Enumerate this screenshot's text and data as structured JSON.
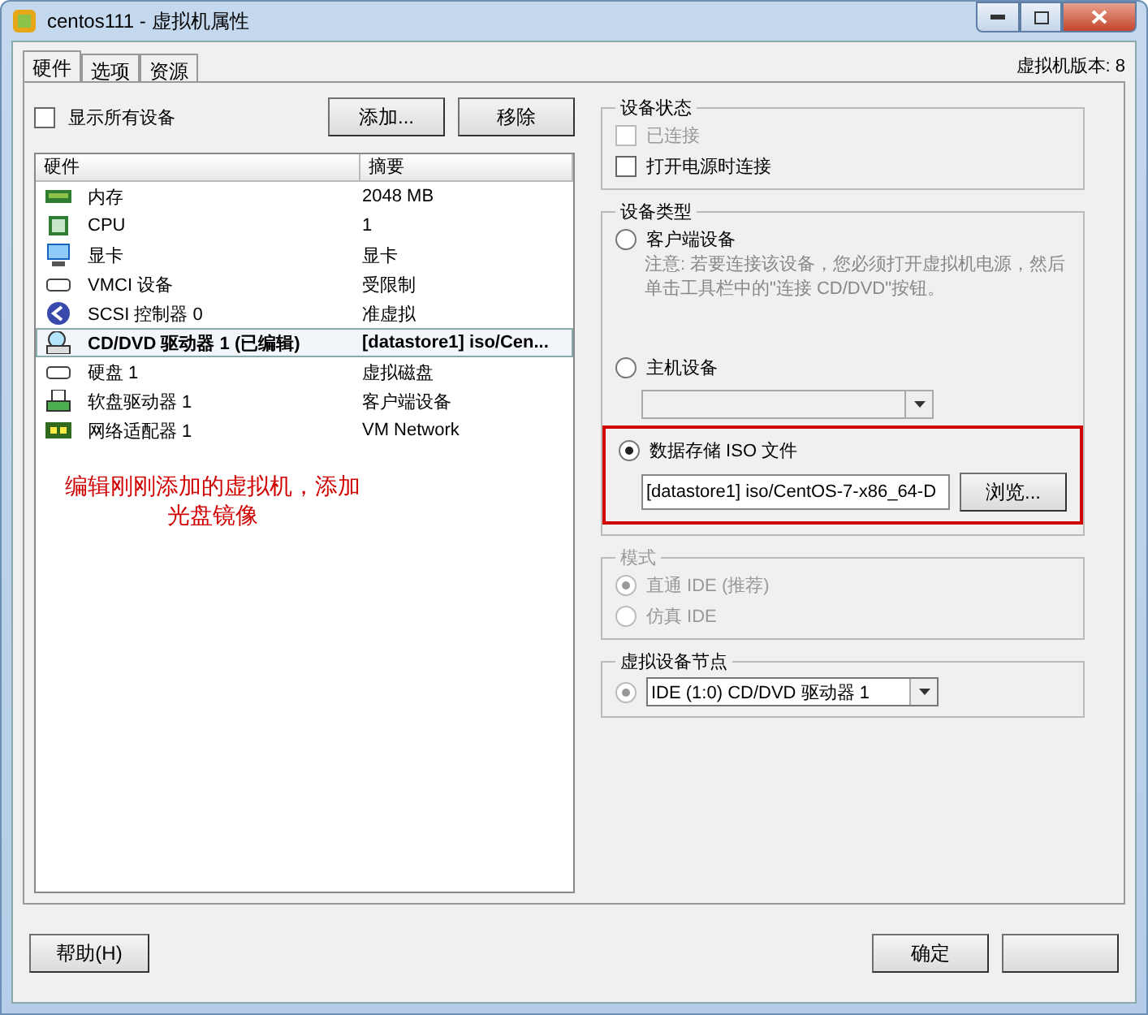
{
  "window": {
    "title": "centos111 - 虚拟机属性"
  },
  "tabs": [
    {
      "label": "硬件",
      "selected": true
    },
    {
      "label": "选项",
      "selected": false
    },
    {
      "label": "资源",
      "selected": false
    }
  ],
  "version_label": "虚拟机版本: 8",
  "show_all_devices": {
    "label": "显示所有设备",
    "checked": false
  },
  "list_buttons": [
    "添加...",
    "移除"
  ],
  "hardware_table": {
    "columns": [
      "硬件",
      "摘要"
    ],
    "rows": [
      {
        "kind": "memory",
        "name": "内存",
        "summary": "2048 MB",
        "selected": false
      },
      {
        "kind": "cpu",
        "name": "CPU",
        "summary": "1",
        "selected": false
      },
      {
        "kind": "display",
        "name": "显卡",
        "summary": "显卡",
        "selected": false
      },
      {
        "kind": "device",
        "name": "VMCI 设备",
        "summary": "受限制",
        "selected": false
      },
      {
        "kind": "controller",
        "name": "SCSI 控制器 0",
        "summary": "准虚拟",
        "selected": false
      },
      {
        "kind": "cdrom",
        "name": "CD/DVD 驱动器 1 (已编辑)",
        "summary": "[datastore1] iso/Cen...",
        "selected": true
      },
      {
        "kind": "device",
        "name": "硬盘 1",
        "summary": "虚拟磁盘",
        "selected": false
      },
      {
        "kind": "floppy",
        "name": "软盘驱动器 1",
        "summary": "客户端设备",
        "selected": false
      },
      {
        "kind": "network",
        "name": "网络适配器 1",
        "summary": "VM Network",
        "selected": false
      }
    ]
  },
  "annotation": [
    "编辑刚刚添加的虚拟机，添加",
    "光盘镜像"
  ],
  "device_status": {
    "title": "设备状态",
    "options": [
      {
        "label": "已连接",
        "checked": false,
        "disabled": true
      },
      {
        "label": "打开电源时连接",
        "checked": false,
        "disabled": false
      }
    ]
  },
  "device_type": {
    "title": "设备类型",
    "options": [
      {
        "kind": "note",
        "label": "客户端设备",
        "selected": false,
        "note": "注意: 若要连接该设备，您必须打开虚拟机电源，然后单击工具栏中的\"连接 CD/DVD\"按钮。"
      },
      {
        "kind": "dropdown",
        "label": "主机设备",
        "selected": false
      },
      {
        "kind": "file",
        "label": "数据存储 ISO 文件",
        "selected": true,
        "value": "[datastore1] iso/CentOS-7-x86_64-D",
        "button": "浏览...",
        "highlighted": true
      }
    ]
  },
  "mode": {
    "title": "模式",
    "disabled": true,
    "options": [
      {
        "label": "直通 IDE (推荐)",
        "selected": true
      },
      {
        "label": "仿真 IDE",
        "selected": false
      }
    ]
  },
  "node": {
    "title": "虚拟设备节点",
    "selected": true,
    "value": "IDE (1:0) CD/DVD 驱动器 1"
  },
  "footer": {
    "help": "帮助(H)",
    "ok": "确定"
  }
}
